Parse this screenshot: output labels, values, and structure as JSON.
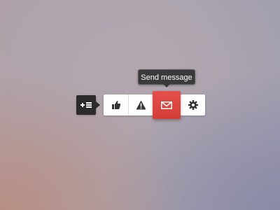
{
  "tooltip": {
    "text": "Send message"
  },
  "toggle": {
    "icon": "add-list-icon"
  },
  "toolbar": {
    "items": [
      {
        "icon": "thumbs-up-icon",
        "active": false
      },
      {
        "icon": "warning-icon",
        "active": false
      },
      {
        "icon": "mail-icon",
        "active": true
      },
      {
        "icon": "gear-icon",
        "active": false
      }
    ],
    "active_color": "#df4a44"
  }
}
